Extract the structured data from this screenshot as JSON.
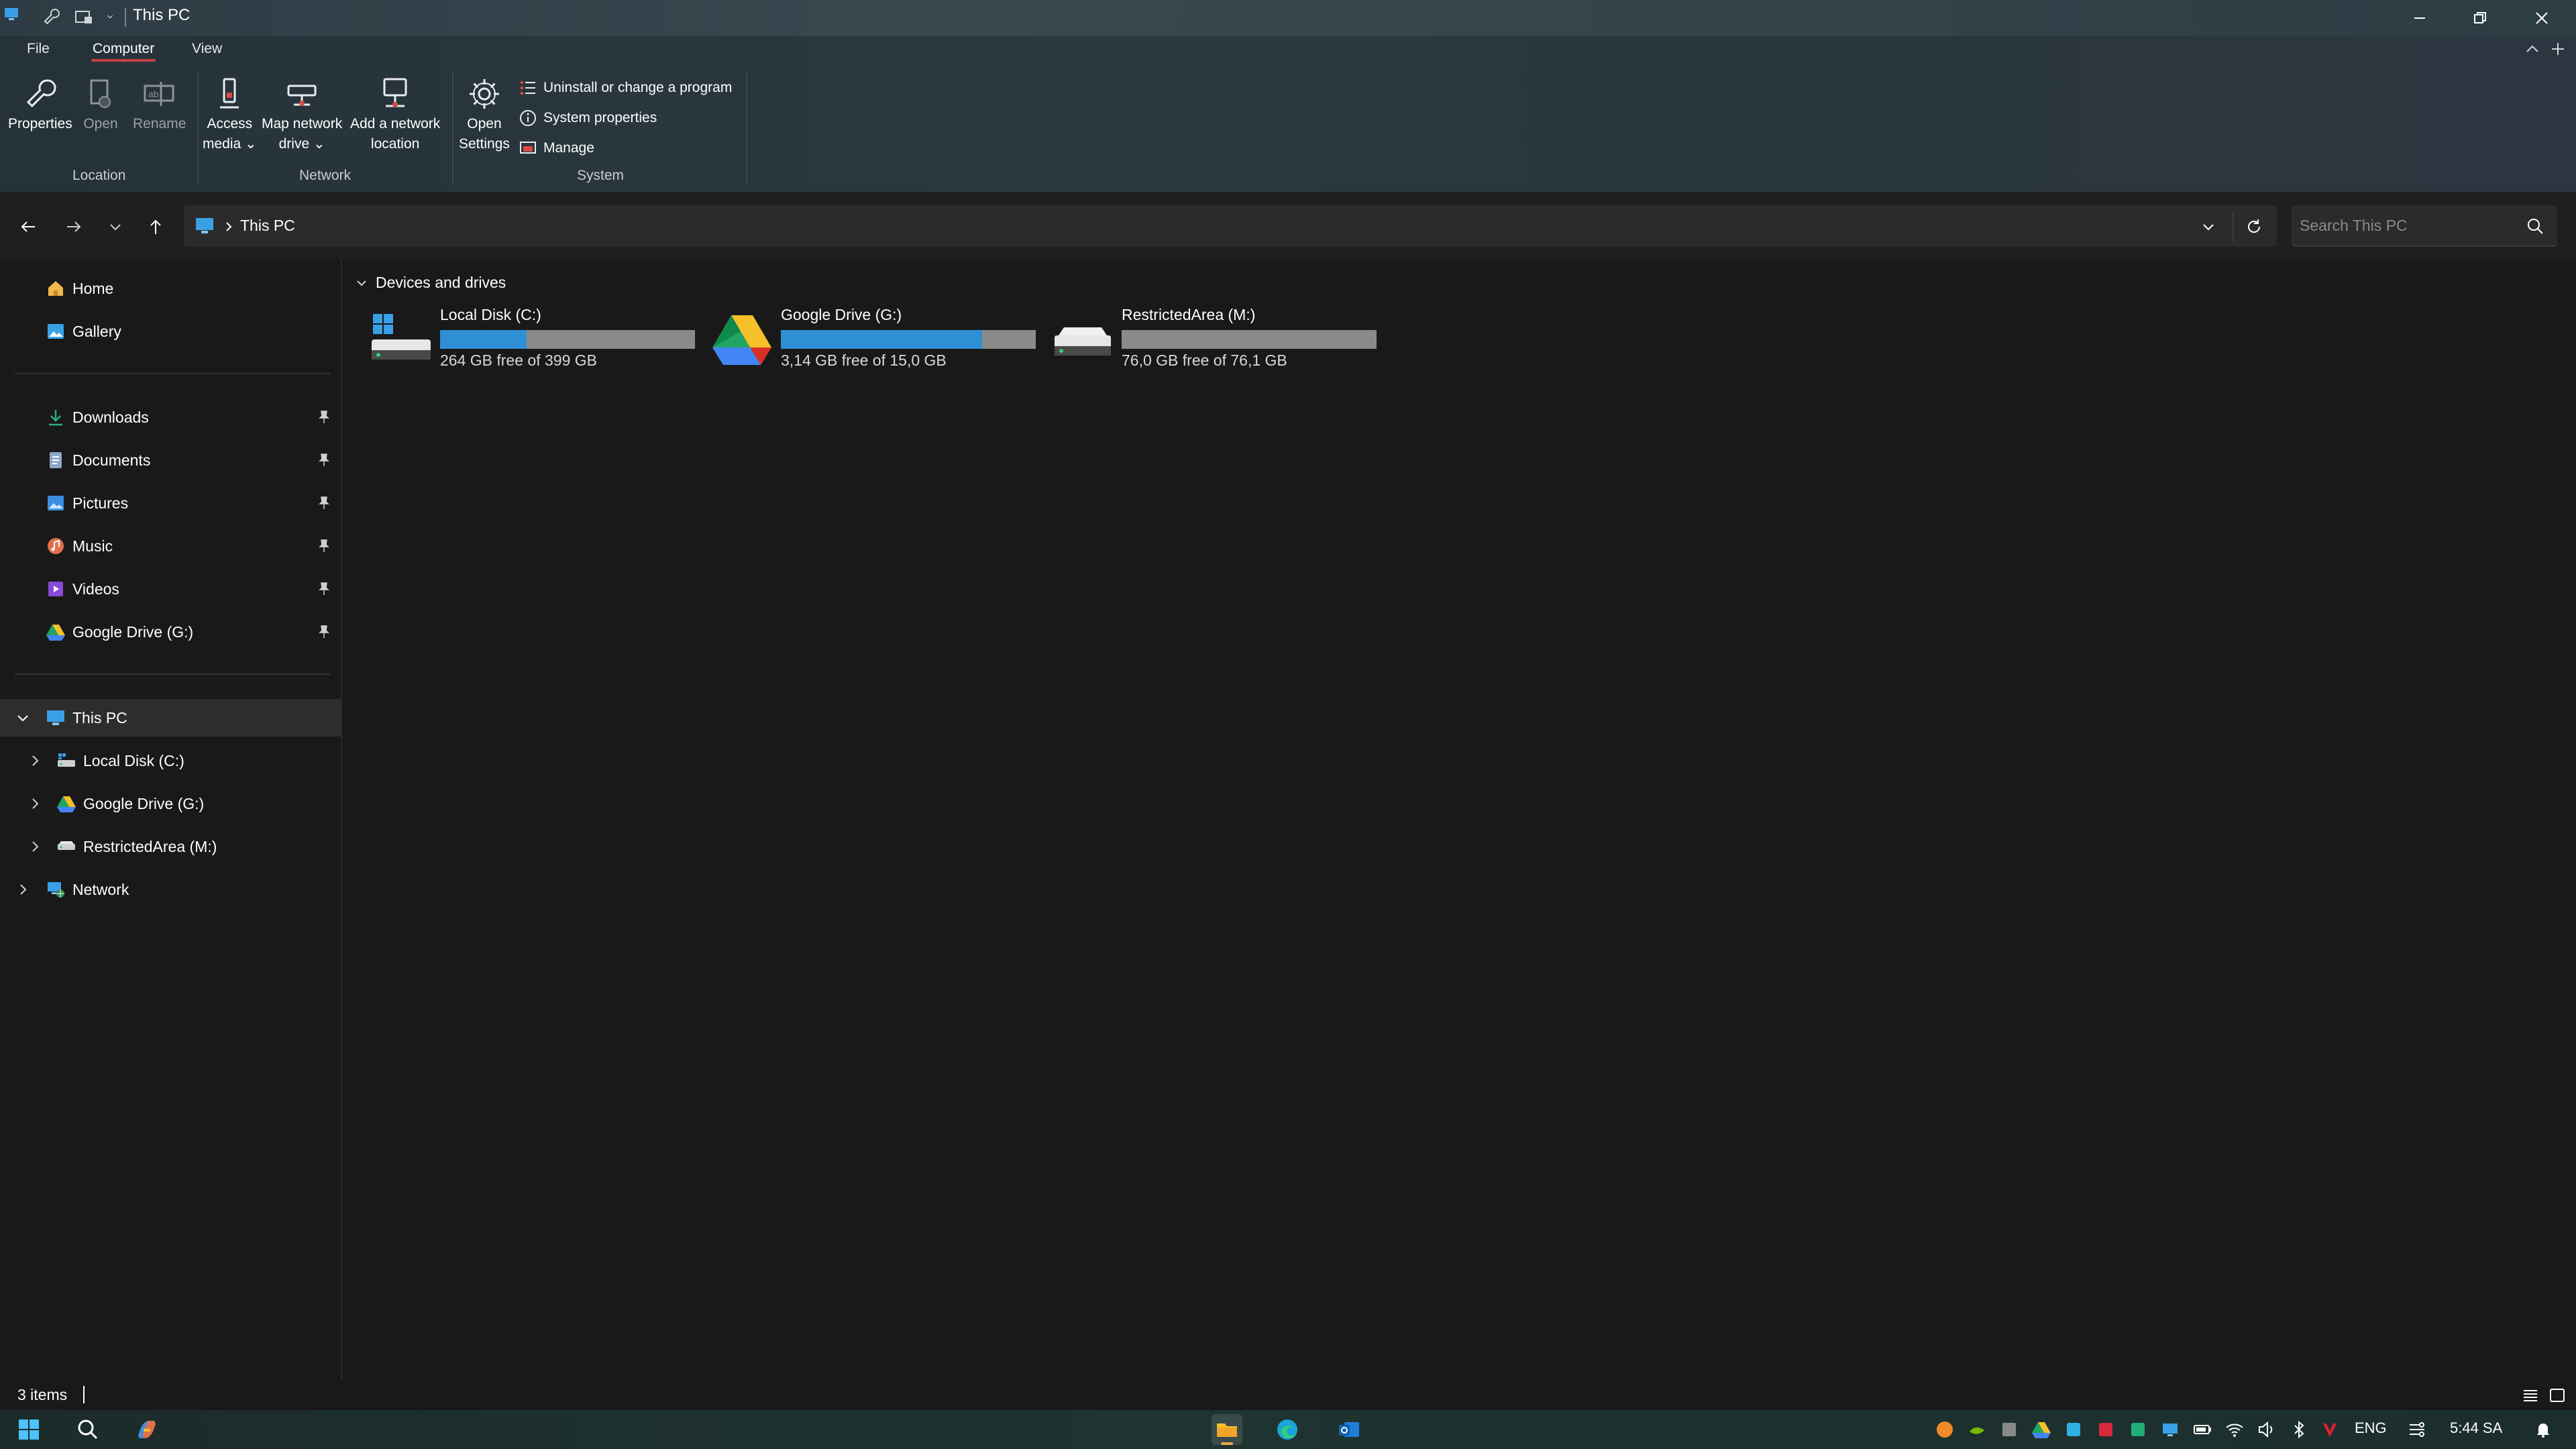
{
  "window": {
    "title": "This PC"
  },
  "ribbon": {
    "tabs": [
      "File",
      "Computer",
      "View"
    ],
    "active_tab": "Computer",
    "groups": {
      "location": {
        "label": "Location",
        "buttons": [
          {
            "label": "Properties",
            "icon": "wrench-icon",
            "enabled": true
          },
          {
            "label": "Open",
            "icon": "open-icon",
            "enabled": false
          },
          {
            "label": "Rename",
            "icon": "rename-icon",
            "enabled": false
          }
        ]
      },
      "network": {
        "label": "Network",
        "buttons": [
          {
            "label_line1": "Access",
            "label_line2": "media",
            "icon": "access-media-icon"
          },
          {
            "label_line1": "Map network",
            "label_line2": "drive",
            "icon": "map-drive-icon"
          },
          {
            "label_line1": "Add a network",
            "label_line2": "location",
            "icon": "network-location-icon"
          }
        ]
      },
      "system": {
        "label": "System",
        "open_settings": {
          "label_line1": "Open",
          "label_line2": "Settings"
        },
        "items": [
          {
            "label": "Uninstall or change a program",
            "icon": "list-icon"
          },
          {
            "label": "System properties",
            "icon": "info-icon"
          },
          {
            "label": "Manage",
            "icon": "manage-icon"
          }
        ]
      }
    }
  },
  "address_bar": {
    "path": "This PC"
  },
  "search": {
    "placeholder": "Search This PC"
  },
  "sidebar": {
    "quick": [
      {
        "label": "Home",
        "icon": "home-icon"
      },
      {
        "label": "Gallery",
        "icon": "gallery-icon"
      }
    ],
    "pinned": [
      {
        "label": "Downloads",
        "icon": "download-icon"
      },
      {
        "label": "Documents",
        "icon": "document-icon"
      },
      {
        "label": "Pictures",
        "icon": "picture-icon"
      },
      {
        "label": "Music",
        "icon": "music-icon"
      },
      {
        "label": "Videos",
        "icon": "video-icon"
      },
      {
        "label": "Google Drive (G:)",
        "icon": "google-drive-icon"
      }
    ],
    "tree": {
      "root": {
        "label": "This PC",
        "icon": "pc-icon",
        "expanded": true,
        "selected": true
      },
      "children": [
        {
          "label": "Local Disk (C:)",
          "icon": "local-disk-icon"
        },
        {
          "label": "Google Drive (G:)",
          "icon": "google-drive-icon"
        },
        {
          "label": "RestrictedArea (M:)",
          "icon": "drive-icon"
        }
      ],
      "network": {
        "label": "Network",
        "icon": "network-icon"
      }
    }
  },
  "content": {
    "section_title": "Devices and drives",
    "drives": [
      {
        "name": "Local Disk (C:)",
        "free_text": "264 GB free of 399 GB",
        "used_fraction": 0.34,
        "icon": "windows-disk-icon"
      },
      {
        "name": "Google Drive (G:)",
        "free_text": "3,14 GB free of 15,0 GB",
        "used_fraction": 0.79,
        "icon": "google-drive-icon"
      },
      {
        "name": "RestrictedArea (M:)",
        "free_text": "76,0 GB free of 76,1 GB",
        "used_fraction": 0.0,
        "icon": "drive-icon"
      }
    ]
  },
  "status_bar": {
    "item_count": "3 items"
  },
  "taskbar": {
    "language": "ENG",
    "clock": "5:44 SA"
  },
  "colors": {
    "accent_blue": "#2f8fd5",
    "active_tab_underline": "#c44141",
    "background": "#191919"
  }
}
